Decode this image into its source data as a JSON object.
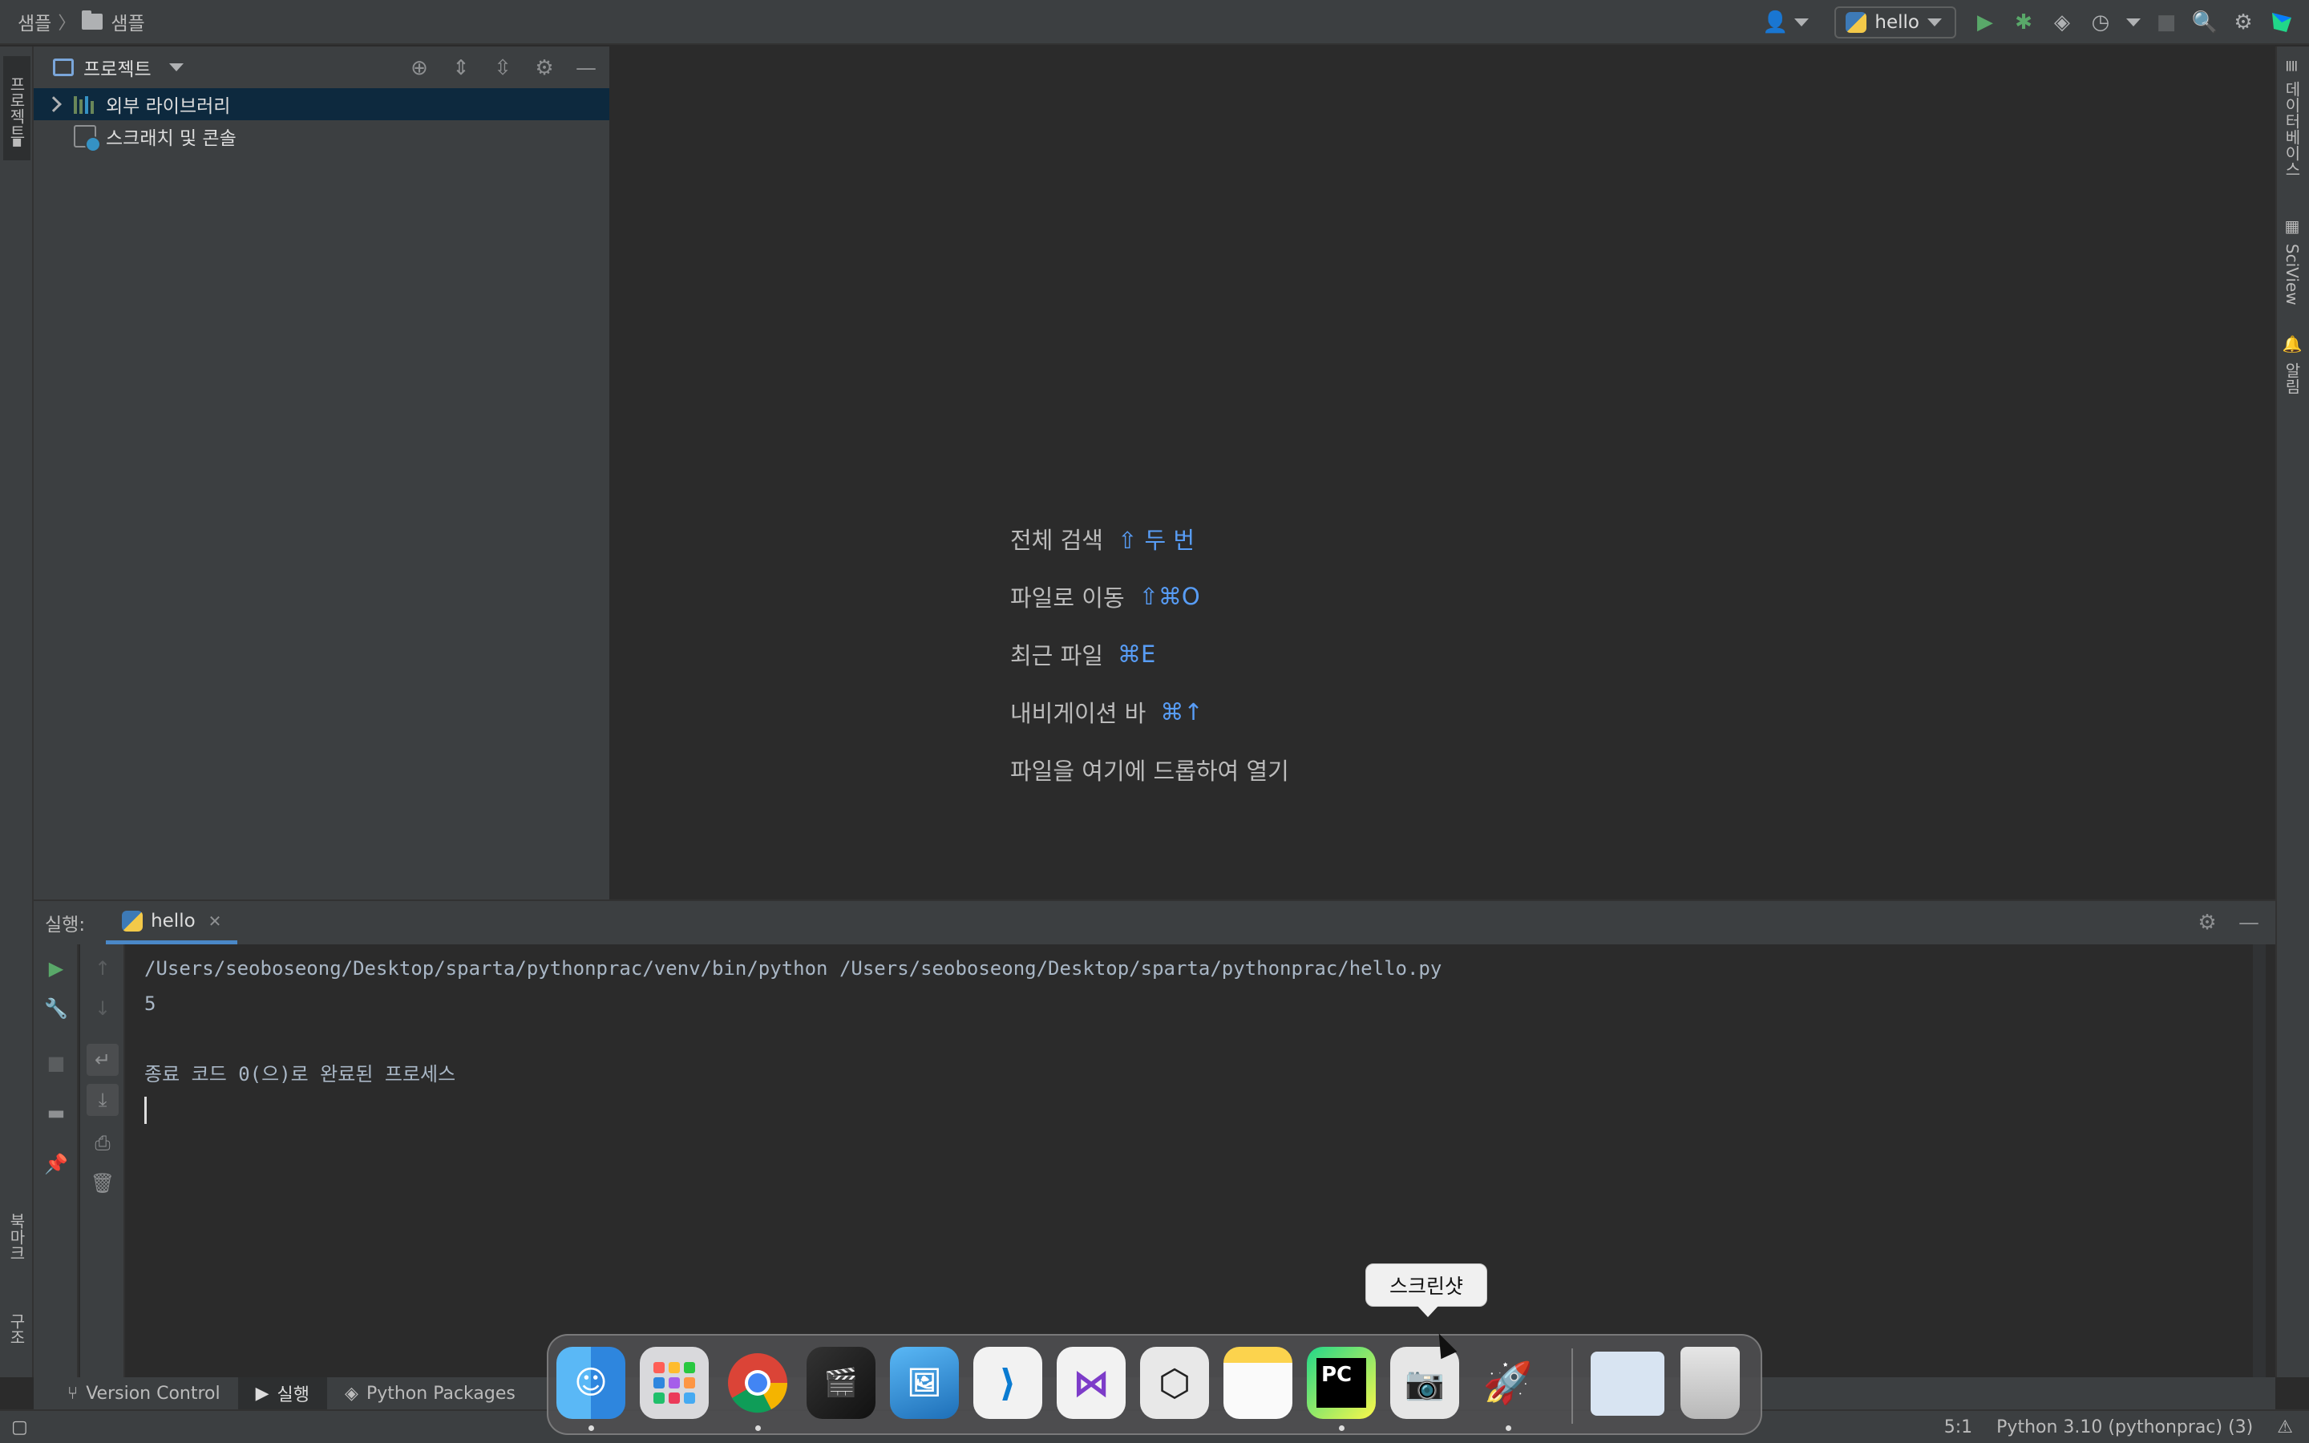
{
  "breadcrumb": {
    "root": "샘플",
    "folder": "샘플"
  },
  "toolbar": {
    "run_config": "hello",
    "icons": [
      "user-icon",
      "python-icon",
      "run-icon",
      "debug-icon",
      "coverage-icon",
      "profile-icon",
      "stop-icon",
      "search-icon",
      "gear-icon",
      "jetbrains-icon"
    ]
  },
  "left_stripe": {
    "project_tab": "프로젝트",
    "bookmarks_tab": "북마크",
    "structure_tab": "구조"
  },
  "right_stripe": {
    "database_tab": "데이터베이스",
    "sciview_tab": "SciView",
    "notifications_tab": "알림"
  },
  "project_panel": {
    "title": "프로젝트",
    "items": [
      {
        "label": "외부 라이브러리",
        "icon": "library-icon"
      },
      {
        "label": "스크래치 및 콘솔",
        "icon": "scratch-icon"
      }
    ]
  },
  "editor_hints": [
    {
      "label": "전체 검색",
      "key": "⇧ 두 번"
    },
    {
      "label": "파일로 이동",
      "key": "⇧⌘O"
    },
    {
      "label": "최근 파일",
      "key": "⌘E"
    },
    {
      "label": "내비게이션 바",
      "key": "⌘↑"
    },
    {
      "label": "파일을 여기에 드롭하여 열기",
      "key": ""
    }
  ],
  "run_panel": {
    "label": "실행:",
    "tab": "hello",
    "console": [
      "/Users/seoboseong/Desktop/sparta/pythonprac/venv/bin/python /Users/seoboseong/Desktop/sparta/pythonprac/hello.py",
      "5",
      "",
      "종료 코드 0(으)로 완료된 프로세스"
    ]
  },
  "bottom_tabs": [
    {
      "label": "Version Control",
      "icon": "branch-icon"
    },
    {
      "label": "실행",
      "icon": "play-icon"
    },
    {
      "label": "Python Packages",
      "icon": "layers-icon"
    }
  ],
  "status": {
    "position": "5:1",
    "interpreter": "Python 3.10 (pythonprac) (3)"
  },
  "dock": {
    "tooltip": "스크린샷",
    "apps": [
      "Finder",
      "Launchpad",
      "Chrome",
      "Final Cut Pro",
      "Preview",
      "VS Code",
      "Visual Studio",
      "Unity",
      "Notes",
      "PyCharm",
      "Screenshot",
      "Rocket"
    ],
    "pycharm_label": "PC",
    "accent_colors": {
      "selection": "#0d293e",
      "link": "#589df6",
      "run_green": "#59a869"
    }
  }
}
